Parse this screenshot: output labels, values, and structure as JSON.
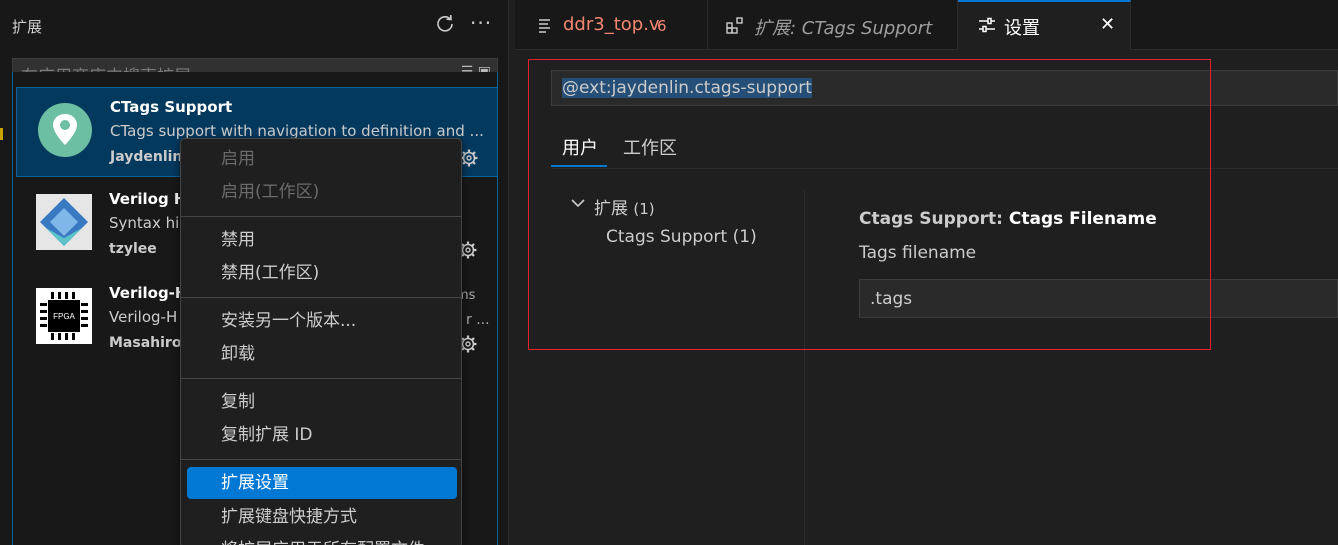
{
  "sidebar": {
    "title": "扩展",
    "search_placeholder": "在应用商店中搜索扩展",
    "extensions": [
      {
        "name": "CTags Support",
        "description": "CTags support with navigation to definition and ...",
        "author": "Jaydenlin",
        "icon": "map-pin-icon",
        "selected": true
      },
      {
        "name": "Verilog H",
        "description": "Syntax hig",
        "author": "tzylee",
        "icon": "diamond-logo-icon"
      },
      {
        "name": "Verilog-H",
        "description": "Verilog-H",
        "author": "Masahiro",
        "icon": "fpga-chip-icon",
        "icon_text": "FPGA",
        "trailing": "ms",
        "trailing_desc": "r ..."
      }
    ]
  },
  "context_menu": {
    "items": [
      {
        "label": "启用",
        "state": "disabled"
      },
      {
        "label": "启用(工作区)",
        "state": "disabled"
      },
      {
        "label": "禁用",
        "state": "normal"
      },
      {
        "label": "禁用(工作区)",
        "state": "normal"
      },
      {
        "label": "安装另一个版本...",
        "state": "normal"
      },
      {
        "label": "卸载",
        "state": "normal"
      },
      {
        "label": "复制",
        "state": "normal"
      },
      {
        "label": "复制扩展 ID",
        "state": "normal"
      },
      {
        "label": "扩展设置",
        "state": "active"
      },
      {
        "label": "扩展键盘快捷方式",
        "state": "normal"
      },
      {
        "label": "将扩展应用于所有配置文件",
        "state": "normal"
      }
    ]
  },
  "tabs": [
    {
      "label": "ddr3_top.v",
      "badge": "6",
      "icon": "file-lines-icon",
      "color": "#f48771"
    },
    {
      "label": "扩展: CTags Support",
      "icon": "extensions-icon",
      "italic": true
    },
    {
      "label": "设置",
      "icon": "settings-sliders-icon",
      "active": true,
      "close": "✕"
    }
  ],
  "settings": {
    "search_value": "@ext:jaydenlin.ctags-support",
    "scope_tabs": [
      {
        "label": "用户",
        "active": true
      },
      {
        "label": "工作区",
        "active": false
      }
    ],
    "toc": {
      "category": "扩展",
      "category_count": "(1)",
      "subcategory": "Ctags Support",
      "subcategory_count": "(1)"
    },
    "setting": {
      "title_prefix": "Ctags Support: ",
      "title_leaf": "Ctags Filename",
      "description": "Tags filename",
      "value": ".tags"
    }
  },
  "colors": {
    "accent": "#0078d4",
    "annotation_box": "#e0242e",
    "error_tab": "#f48771"
  }
}
